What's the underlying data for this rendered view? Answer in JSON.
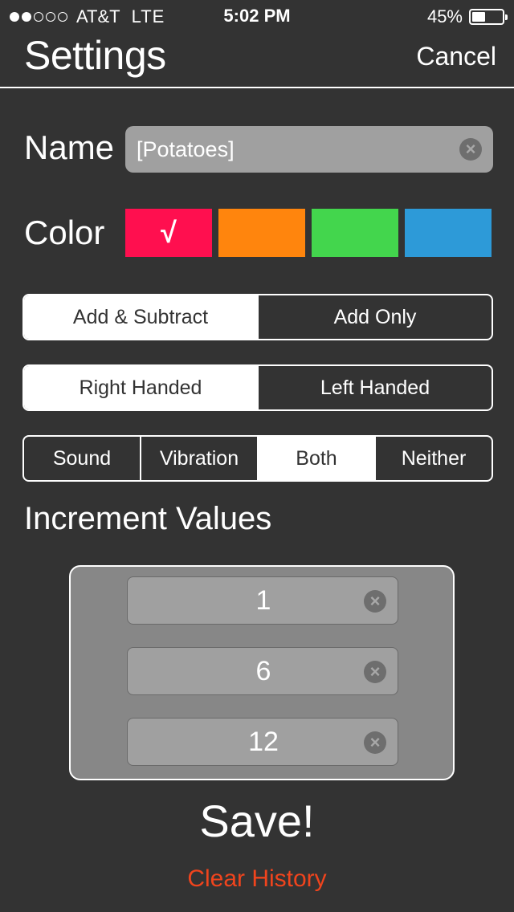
{
  "status_bar": {
    "signal_bars": 2,
    "signal_total": 5,
    "carrier": "AT&T",
    "network": "LTE",
    "time": "5:02 PM",
    "battery_percent": "45%",
    "battery_level": 0.45
  },
  "nav": {
    "title": "Settings",
    "cancel_label": "Cancel"
  },
  "name": {
    "label": "Name",
    "value": "[Potatoes]",
    "clear_icon": "×"
  },
  "color": {
    "label": "Color",
    "swatches": [
      {
        "name": "red",
        "hex": "#ff0f4f",
        "selected": true
      },
      {
        "name": "orange",
        "hex": "#ff850d",
        "selected": false
      },
      {
        "name": "green",
        "hex": "#43d64d",
        "selected": false
      },
      {
        "name": "blue",
        "hex": "#2d9ad8",
        "selected": false
      }
    ],
    "check_mark": "√"
  },
  "mode_segment": {
    "options": [
      "Add & Subtract",
      "Add Only"
    ],
    "selected": 0
  },
  "hand_segment": {
    "options": [
      "Right Handed",
      "Left Handed"
    ],
    "selected": 0
  },
  "feedback_segment": {
    "options": [
      "Sound",
      "Vibration",
      "Both",
      "Neither"
    ],
    "selected": 2
  },
  "increments": {
    "title": "Increment Values",
    "values": [
      "1",
      "6",
      "12"
    ],
    "clear_icon": "×"
  },
  "footer": {
    "save_label": "Save!",
    "clear_history_label": "Clear History",
    "clear_history_color": "#f0441d"
  }
}
